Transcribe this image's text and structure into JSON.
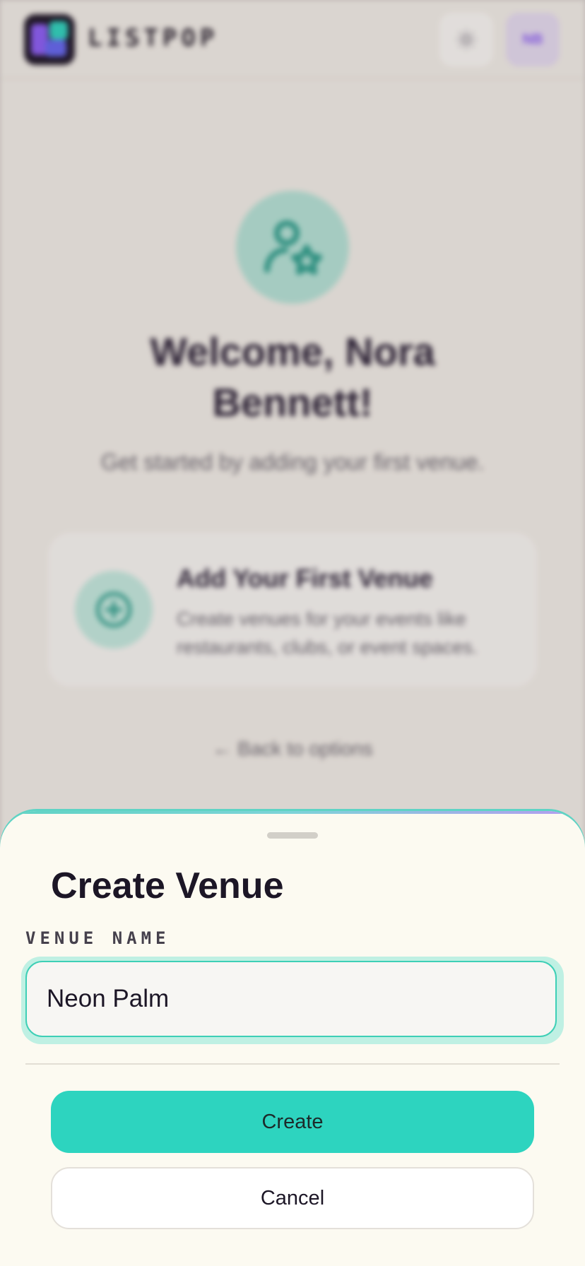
{
  "app": {
    "logo_text": "LISTPOP"
  },
  "header": {
    "theme_icon": "sun-icon",
    "avatar_initials": "NB"
  },
  "welcome": {
    "title": "Welcome, Nora Bennett!",
    "subtitle": "Get started by adding your first venue."
  },
  "venue_card": {
    "title": "Add Your First Venue",
    "description": "Create venues for your events like restaurants, clubs, or event spaces."
  },
  "back_link": "← Back to options",
  "sheet": {
    "title": "Create Venue",
    "field_label": "VENUE NAME",
    "field_value": "Neon Palm",
    "create_label": "Create",
    "cancel_label": "Cancel"
  },
  "colors": {
    "accent": "#2dd4bf",
    "brand_purple": "#8b5cf6",
    "sheet_background": "#fcfaf1"
  }
}
